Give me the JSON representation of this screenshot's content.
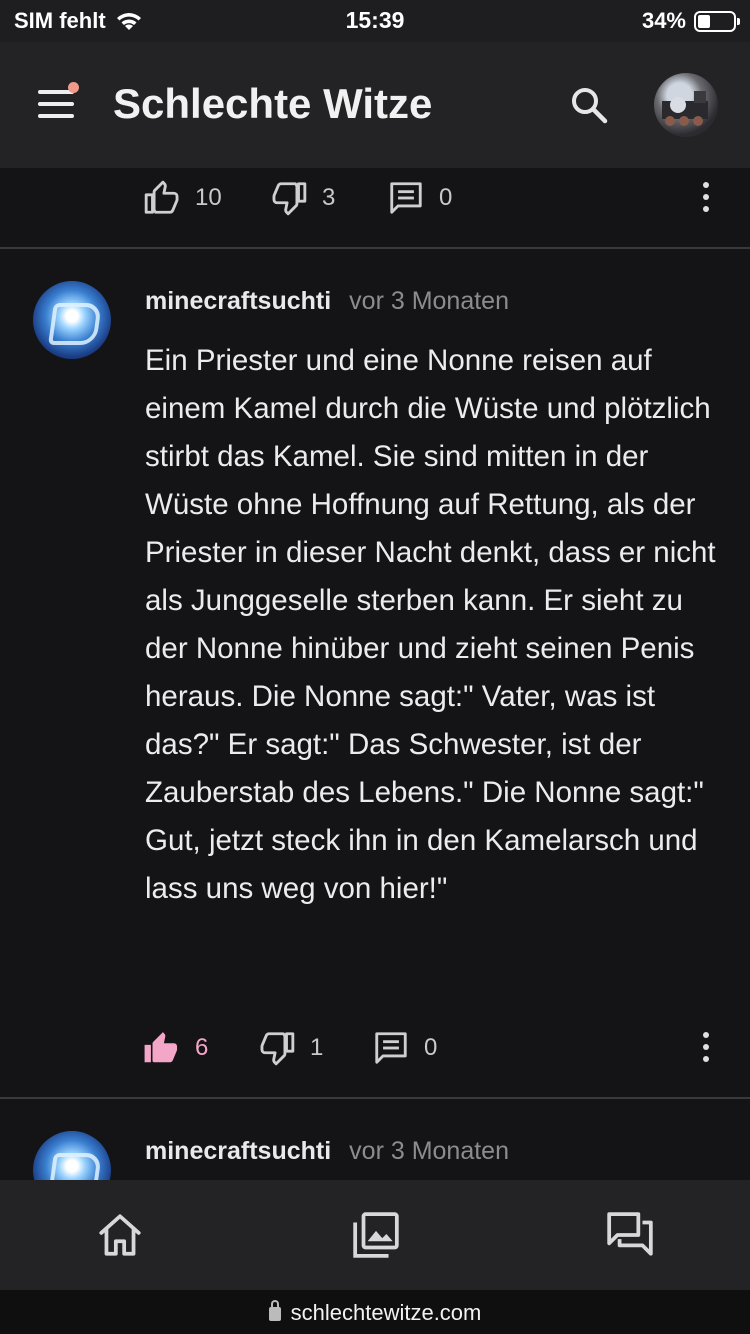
{
  "status_bar": {
    "carrier": "SIM fehlt",
    "time": "15:39",
    "battery": "34%",
    "battery_level": 0.34
  },
  "header": {
    "title": "Schlechte Witze"
  },
  "posts": [
    {
      "likes": "10",
      "dislikes": "3",
      "comments": "0",
      "liked": false
    },
    {
      "author": "minecraftsuchti",
      "time": "vor 3 Monaten",
      "text": "Ein Priester und eine Nonne reisen auf einem Kamel durch die Wüste und plötzlich stirbt das Kamel. Sie sind mitten in der Wüste ohne Hoffnung auf Rettung, als der Priester in dieser Nacht denkt, dass er nicht als Junggeselle sterben kann. Er sieht zu der Nonne hinüber und zieht seinen Penis heraus. Die Nonne sagt:\" Vater, was ist das?\" Er sagt:\" Das Schwester, ist der Zauberstab des Lebens.\" Die Nonne sagt:\" Gut, jetzt steck ihn in den Kamelarsch und lass uns weg von hier!\"",
      "likes": "6",
      "dislikes": "1",
      "comments": "0",
      "liked": true
    },
    {
      "author": "minecraftsuchti",
      "time": "vor 3 Monaten"
    }
  ],
  "bottom_nav": [
    "home-icon",
    "gallery-icon",
    "forum-icon"
  ],
  "url": "schlechtewitze.com",
  "colors": {
    "accent_liked": "#f4a6c8",
    "background": "#141416",
    "appbar": "#232325"
  }
}
